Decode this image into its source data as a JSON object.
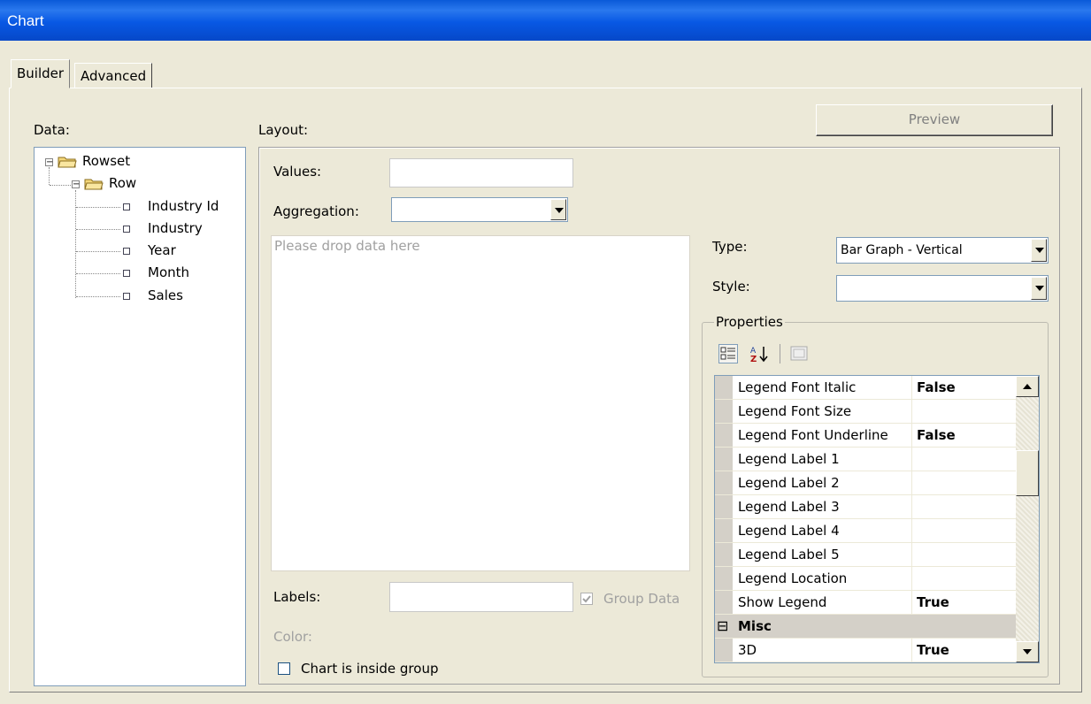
{
  "window": {
    "title": "Chart"
  },
  "tabs": [
    {
      "label": "Builder",
      "active": true
    },
    {
      "label": "Advanced",
      "active": false
    }
  ],
  "data_panel": {
    "label": "Data:",
    "tree": {
      "root": "Rowset",
      "child": "Row",
      "fields": [
        "Industry Id",
        "Industry",
        "Year",
        "Month",
        "Sales"
      ]
    }
  },
  "layout": {
    "label": "Layout:",
    "values_label": "Values:",
    "values_value": "",
    "aggregation_label": "Aggregation:",
    "aggregation_value": "",
    "dropzone_placeholder": "Please drop data here",
    "labels_label": "Labels:",
    "labels_value": "",
    "group_data_label": "Group Data",
    "group_data_checked": true,
    "color_label": "Color:",
    "chart_inside_group_label": "Chart is inside group",
    "chart_inside_group_checked": false
  },
  "preview_button": "Preview",
  "type_label": "Type:",
  "type_value": "Bar Graph - Vertical",
  "style_label": "Style:",
  "style_value": "",
  "properties": {
    "title": "Properties",
    "rows": [
      {
        "name": "Legend Font Italic",
        "value": "False"
      },
      {
        "name": "Legend Font Size",
        "value": ""
      },
      {
        "name": "Legend Font Underline",
        "value": "False"
      },
      {
        "name": "Legend Label 1",
        "value": ""
      },
      {
        "name": "Legend Label 2",
        "value": ""
      },
      {
        "name": "Legend Label 3",
        "value": ""
      },
      {
        "name": "Legend Label 4",
        "value": ""
      },
      {
        "name": "Legend Label 5",
        "value": ""
      },
      {
        "name": "Legend Location",
        "value": ""
      },
      {
        "name": "Show Legend",
        "value": "True"
      }
    ],
    "category": {
      "name": "Misc",
      "expand_glyph": "⊟"
    },
    "misc_rows": [
      {
        "name": "3D",
        "value": "True"
      }
    ]
  }
}
